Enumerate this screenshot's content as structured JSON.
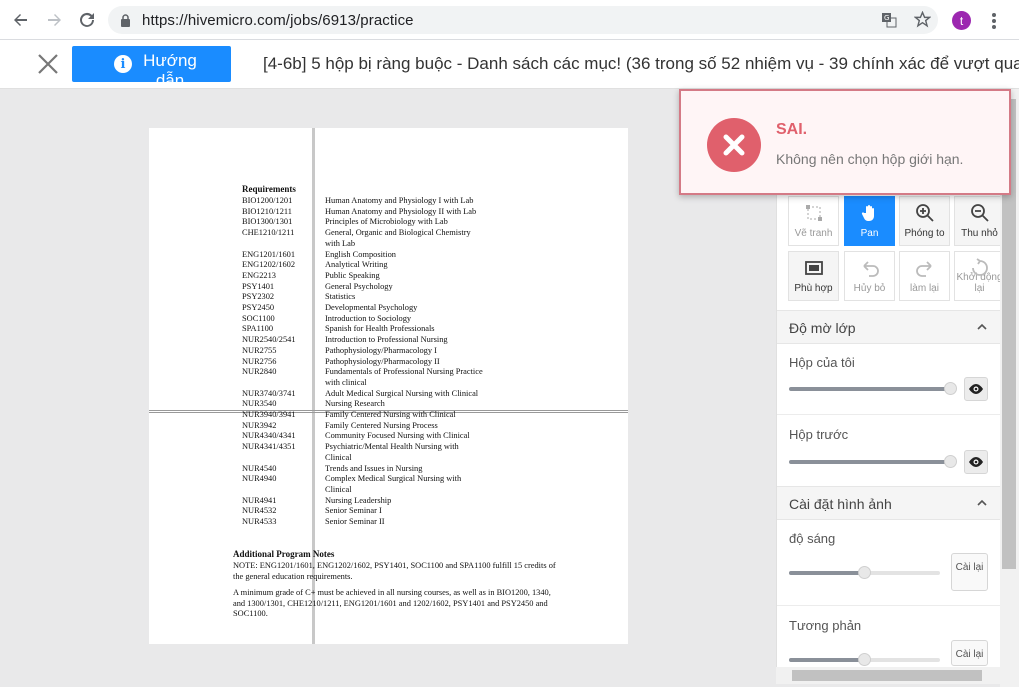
{
  "browser": {
    "url": "https://hivemicro.com/jobs/6913/practice",
    "avatar_letter": "t"
  },
  "header": {
    "guide_label": "Hướng dẫn",
    "task_title": "[4-6b] 5 hộp bị ràng buộc - Danh sách các mục! (36 trong số 52 nhiệm vụ - 39 chính xác để vượt qua)"
  },
  "document": {
    "requirements_heading": "Requirements",
    "rows": [
      {
        "code": "BIO1200/1201",
        "name": "Human Anatomy and Physiology I with Lab"
      },
      {
        "code": "BIO1210/1211",
        "name": "Human Anatomy and Physiology II with Lab"
      },
      {
        "code": "BIO1300/1301",
        "name": "Principles of Microbiology with Lab"
      },
      {
        "code": "CHE1210/1211",
        "name": "General, Organic and Biological Chemistry"
      },
      {
        "code": "",
        "name": "with Lab"
      },
      {
        "code": "ENG1201/1601",
        "name": "English Composition"
      },
      {
        "code": "ENG1202/1602",
        "name": "Analytical Writing"
      },
      {
        "code": "ENG2213",
        "name": "Public Speaking"
      },
      {
        "code": "PSY1401",
        "name": "General Psychology"
      },
      {
        "code": "PSY2302",
        "name": "Statistics"
      },
      {
        "code": "PSY2450",
        "name": "Developmental Psychology"
      },
      {
        "code": "SOC1100",
        "name": "Introduction to Sociology"
      },
      {
        "code": "SPA1100",
        "name": "Spanish for Health Professionals"
      },
      {
        "code": "NUR2540/2541",
        "name": "Introduction to Professional Nursing"
      },
      {
        "code": "NUR2755",
        "name": "Pathophysiology/Pharmacology I"
      },
      {
        "code": "NUR2756",
        "name": "Pathophysiology/Pharmacology II"
      },
      {
        "code": "NUR2840",
        "name": "Fundamentals of Professional Nursing Practice"
      },
      {
        "code": "",
        "name": "with clinical"
      },
      {
        "code": "NUR3740/3741",
        "name": "Adult Medical Surgical Nursing with Clinical"
      },
      {
        "code": "NUR3540",
        "name": "Nursing Research"
      },
      {
        "code": "NUR3940/3941",
        "name": "Family Centered Nursing with Clinical"
      },
      {
        "code": "NUR3942",
        "name": "Family Centered Nursing Process"
      },
      {
        "code": "NUR4340/4341",
        "name": "Community Focused Nursing with Clinical"
      },
      {
        "code": "NUR4341/4351",
        "name": "Psychiatric/Mental Health Nursing with"
      },
      {
        "code": "",
        "name": "Clinical"
      },
      {
        "code": "NUR4540",
        "name": "Trends and Issues in Nursing"
      },
      {
        "code": "NUR4940",
        "name": "Complex Medical Surgical Nursing with"
      },
      {
        "code": "",
        "name": "Clinical"
      },
      {
        "code": "NUR4941",
        "name": "Nursing Leadership"
      },
      {
        "code": "NUR4532",
        "name": "Senior Seminar I"
      },
      {
        "code": "NUR4533",
        "name": "Senior Seminar II"
      }
    ],
    "notes_heading": "Additional Program Notes",
    "note1": "NOTE: ENG1201/1601, ENG1202/1602, PSY1401, SOC1100 and SPA1100 fulfill 15 credits of the general education requirements.",
    "note2": "A minimum grade of C+ must be achieved in all nursing courses, as well as in BIO1200, 1340, and 1300/1301, CHE1210/1211, ENG1201/1601 and 1202/1602, PSY1401 and PSY2450 and SOC1100."
  },
  "tools": {
    "draw": "Vẽ tranh",
    "pan": "Pan",
    "zoom_in": "Phóng to",
    "zoom_out": "Thu nhỏ",
    "fit": "Phù hợp",
    "undo": "Hủy bỏ",
    "redo": "làm lại",
    "restart": "Khởi động lại"
  },
  "panel": {
    "opacity_section": "Độ mờ lớp",
    "my_boxes": "Hộp của tôi",
    "my_boxes_value": 0.97,
    "previous_boxes": "Hộp trước",
    "previous_boxes_value": 0.97,
    "image_section": "Cài đặt hình ảnh",
    "brightness": "độ sáng",
    "brightness_value": 0.5,
    "contrast": "Tương phản",
    "contrast_value": 0.5,
    "reset": "Cài lại"
  },
  "toast": {
    "title": "SAI.",
    "message": "Không nên chọn hộp giới hạn."
  },
  "colors": {
    "accent": "#1a8cff",
    "error": "#e0606c"
  }
}
